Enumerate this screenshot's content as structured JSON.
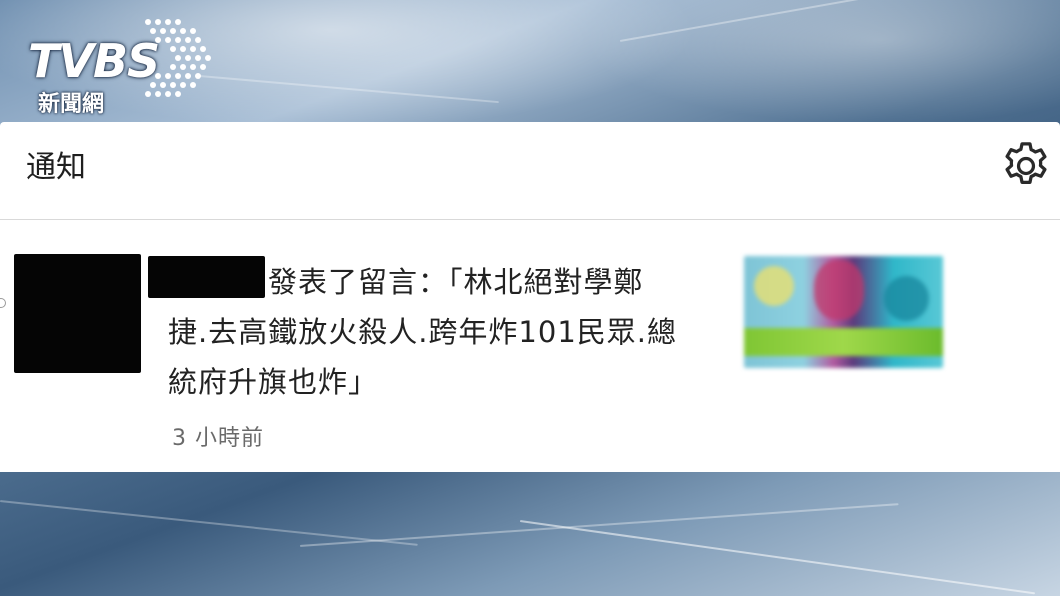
{
  "brand": {
    "logo_text": "TVBS",
    "logo_subtext": "新聞網"
  },
  "panel": {
    "title": "通知",
    "settings_icon": "gear-icon"
  },
  "notification": {
    "line1": "發表了留言：「林北絕對學鄭",
    "line2": "捷.去高鐵放火殺人.跨年炸101民眾.總",
    "line3": "統府升旗也炸」",
    "time": "3 小時前"
  },
  "colors": {
    "panel_bg": "#ffffff",
    "redaction": "#050505",
    "text": "#222222",
    "muted": "#6a6a6a"
  }
}
